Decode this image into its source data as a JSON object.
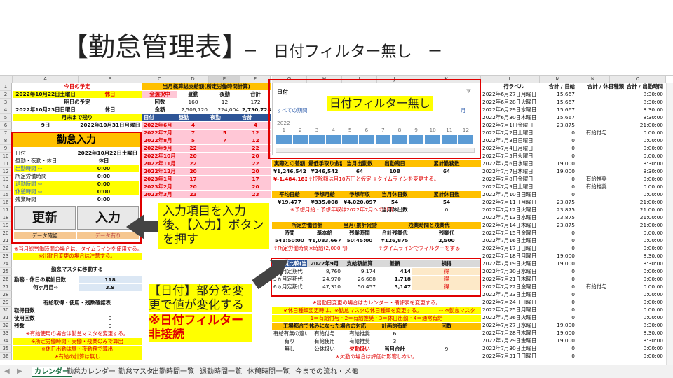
{
  "title": "【勤怠管理表】",
  "subtitle": "－　日付フィルター無し　－",
  "columns": [
    "A",
    "B",
    "C",
    "D",
    "E",
    "F",
    "G",
    "H",
    "I",
    "J",
    "K",
    "L",
    "M",
    "N",
    "O"
  ],
  "rows": [
    "1",
    "2",
    "3",
    "4",
    "5",
    "6",
    "7",
    "8",
    "9",
    "10",
    "11",
    "12",
    "13",
    "14",
    "15",
    "16",
    "17",
    "18",
    "19",
    "20",
    "21",
    "22",
    "23",
    "24",
    "25",
    "26",
    "27",
    "28",
    "29",
    "30",
    "31",
    "32",
    "33",
    "34",
    "35",
    "36"
  ],
  "left": {
    "today_label": "今日の予定",
    "r2a": "2022年10月22日土曜日",
    "r2b": "休日",
    "tomorrow_label": "明日の予定",
    "r4a": "2022年10月23日日曜日",
    "r4b": "休日",
    "month_end": "月末まで残り",
    "r6a": "9日",
    "r6b": "2022年10月31日月曜日",
    "panel_title": "勤怠入力",
    "date_lbl": "日付",
    "date_val": "2022年10月22日土曜日",
    "type_lbl": "昼勤・夜勤・休日",
    "type_val": "休日",
    "work_in": "出勤時間 ⇦",
    "work_in_v": "0:00",
    "sched_out": "所定労働時間",
    "sched_out_v": "0:00",
    "work_out": "退勤時間 ⇦",
    "work_out_v": "0:00",
    "break": "休憩時間 ⇦",
    "break_v": "0:00",
    "overtime": "残業時間",
    "overtime_v": "0:00",
    "btn_update": "更新",
    "btn_input": "入力",
    "data_confirm": "データ確認",
    "data_have": "データ有り",
    "note1": "※当月総労働時間の場合は、タイムラインを使用する。",
    "note2": "※出勤日変更の場合は注意する。",
    "master_move": "勤怠マスタに移動する",
    "attend_lbl": "勤務・休日の累計日数",
    "attend_v": "118",
    "count_lbl": "何ヶ月目⇨",
    "count_v": "3.9",
    "paid_title": "有給取得・使用・残数確認表",
    "paid_get": "取得日数",
    "paid_use": "使用回数",
    "paid_use_v": "0",
    "paid_rem": "残数",
    "paid_rem_v": "0",
    "note3": "※有給使用の場合は勤怠マスタを変更する。",
    "note4": "※所定労働時間・実働・残業のみで算出",
    "note5": "※休日出勤は昼・夜勤務で算出",
    "note6": "※有給の計算は無し"
  },
  "mid": {
    "head": "当月概算総支給額(所定労働時間計算)",
    "sel_all": "全選択中",
    "col_day": "昼勤",
    "col_night": "夜勤",
    "col_total": "合計",
    "times_lbl": "回数",
    "times_d": "160",
    "times_n": "12",
    "times_t": "172",
    "amt_lbl": "金額",
    "amt_d": "2,506,720",
    "amt_n": "224,004",
    "amt_t": "2,730,724",
    "f_date": "日付",
    "f_day": "昼勤",
    "f_night": "夜勤",
    "f_total": "合計",
    "months": [
      {
        "m": "2022年6月",
        "d": "4",
        "n": "",
        "t": "4"
      },
      {
        "m": "2022年7月",
        "d": "7",
        "n": "5",
        "t": "12"
      },
      {
        "m": "2022年8月",
        "d": "5",
        "n": "7",
        "t": "12"
      },
      {
        "m": "2022年9月",
        "d": "22",
        "n": "",
        "t": "22"
      },
      {
        "m": "2022年10月",
        "d": "20",
        "n": "",
        "t": "20"
      },
      {
        "m": "2022年11月",
        "d": "22",
        "n": "",
        "t": "22"
      },
      {
        "m": "2022年12月",
        "d": "20",
        "n": "",
        "t": "20"
      },
      {
        "m": "2023年1月",
        "d": "17",
        "n": "",
        "t": "17"
      },
      {
        "m": "2023年2月",
        "d": "20",
        "n": "",
        "t": "20"
      },
      {
        "m": "2023年3月",
        "d": "23",
        "n": "",
        "t": "23"
      }
    ]
  },
  "right": {
    "r1": [
      "実際との差額",
      "最低手取り金額",
      "当月出勤数",
      "出勤残日",
      "累計勤務数"
    ],
    "r1v": [
      "¥1,246,542",
      "¥246,542",
      "64",
      "108",
      "64"
    ],
    "r1n1": "¥-1,484,182",
    "r1n2": "⇧控除額は月10万円と仮定 ※タイムラインを変更する。",
    "r2": [
      "平均日給",
      "予想月給",
      "予想年収",
      "当月休日数",
      "累計休日数"
    ],
    "r2v": [
      "¥19,477",
      "¥335,008",
      "¥4,020,097",
      "54",
      "54"
    ],
    "r2n": "※予想月給・予想年収は2022年7月への計算",
    "r2n2": "当月休出数",
    "r2n2v": "0",
    "r3": [
      "所定労働合計",
      "",
      "当月(累計)合計",
      "残業時間と残業代",
      ""
    ],
    "r3b": [
      "時間",
      "基本給",
      "残業時間",
      "合計残業代",
      "残業代"
    ],
    "r3v": [
      "541:50:00",
      "¥1,083,667",
      "50:45:00",
      "¥126,875",
      "2,500"
    ],
    "r3n1": "⇧所定労働時間×時給(2,000円)",
    "r3n2": "⇧タイムラインでフィルターをする",
    "e_head": [
      "電車賃比較(当月含む)",
      "2022年9月",
      "支給額計算",
      "差額",
      "損得"
    ],
    "e_rows": [
      [
        "1ヵ月定期代",
        "8,760",
        "9,174",
        "414",
        "得"
      ],
      [
        "3ヵ月定期代",
        "24,970",
        "26,688",
        "1,718",
        "得"
      ],
      [
        "6ヵ月定期代",
        "47,310",
        "50,457",
        "3,147",
        "得"
      ]
    ],
    "note1": "※出勤日変更の場合はカレンダー・備評表を変更する。",
    "note2": "※休日種類変更時は、※勤怠マスタの休日種類を変更する。",
    "note2b": "⇨ ※勤怠マスタ",
    "note3": "1＝有給付与・2＝有給推奨・3＝休日出勤・4＝通常有給",
    "w_head": [
      "工場都合で休みになった場合の対応",
      "",
      "計画的有給",
      "回数"
    ],
    "w_rows": [
      [
        "有給有無の違い",
        "有給付与",
        "有給推奨",
        "6"
      ],
      [
        "有り",
        "有給使用",
        "有給推奨",
        "3"
      ],
      [
        "無し",
        "公休扱い",
        "欠勤扱い",
        "当月合計",
        "9"
      ]
    ],
    "note4": "※欠勤の場合は評価に影響しない。"
  },
  "slicer": {
    "title": "日付",
    "all": "すべての期間",
    "month": "月",
    "year": "2022",
    "months": [
      "1",
      "2",
      "3",
      "4",
      "5",
      "6",
      "7",
      "8",
      "9",
      "10",
      "11",
      "12"
    ]
  },
  "calendar": {
    "head_l": "行ラベル",
    "head_m": "合計 / 日給",
    "head_n": "合計 / 休日種類",
    "head_o": "合計 / 出勤時間",
    "rows": [
      [
        "2022年6月27日月曜日",
        "15,667",
        "",
        "8:30:00"
      ],
      [
        "2022年6月28日火曜日",
        "15,667",
        "",
        "8:30:00"
      ],
      [
        "2022年6月29日水曜日",
        "15,667",
        "",
        "8:30:00"
      ],
      [
        "2022年6月30日木曜日",
        "15,667",
        "",
        "8:30:00"
      ],
      [
        "2022年7月1日金曜日",
        "23,875",
        "",
        "21:00:00"
      ],
      [
        "2022年7月2日土曜日",
        "0",
        "有給付与",
        "0:00:00"
      ],
      [
        "2022年7月3日日曜日",
        "0",
        "",
        "0:00:00"
      ],
      [
        "2022年7月4日月曜日",
        "0",
        "",
        "0:00:00"
      ],
      [
        "2022年7月5日火曜日",
        "0",
        "",
        "0:00:00"
      ],
      [
        "2022年7月6日水曜日",
        "19,000",
        "",
        "8:30:00"
      ],
      [
        "2022年7月7日木曜日",
        "19,000",
        "",
        "8:30:00"
      ],
      [
        "2022年7月8日金曜日",
        "0",
        "有給推奨",
        "0:00:00"
      ],
      [
        "2022年7月9日土曜日",
        "0",
        "有給推奨",
        "0:00:00"
      ],
      [
        "2022年7月10日日曜日",
        "0",
        "",
        "0:00:00"
      ],
      [
        "2022年7月11日月曜日",
        "23,875",
        "",
        "21:00:00"
      ],
      [
        "2022年7月12日火曜日",
        "23,875",
        "",
        "21:00:00"
      ],
      [
        "2022年7月13日水曜日",
        "23,875",
        "",
        "21:00:00"
      ],
      [
        "2022年7月14日木曜日",
        "23,875",
        "",
        "21:00:00"
      ],
      [
        "2022年7月15日金曜日",
        "0",
        "",
        "0:00:00"
      ],
      [
        "2022年7月16日土曜日",
        "0",
        "",
        "0:00:00"
      ],
      [
        "2022年7月17日日曜日",
        "0",
        "",
        "0:00:00"
      ],
      [
        "2022年7月18日月曜日",
        "19,000",
        "",
        "8:30:00"
      ],
      [
        "2022年7月19日火曜日",
        "19,000",
        "",
        "8:30:00"
      ],
      [
        "2022年7月20日水曜日",
        "0",
        "",
        "0:00:00"
      ],
      [
        "2022年7月21日木曜日",
        "0",
        "",
        "0:00:00"
      ],
      [
        "2022年7月22日金曜日",
        "0",
        "有給付与",
        "0:00:00"
      ],
      [
        "2022年7月23日土曜日",
        "0",
        "",
        "0:00:00"
      ],
      [
        "2022年7月24日日曜日",
        "0",
        "",
        "0:00:00"
      ],
      [
        "2022年7月25日月曜日",
        "0",
        "",
        "0:00:00"
      ],
      [
        "2022年7月26日火曜日",
        "0",
        "",
        "0:00:00"
      ],
      [
        "2022年7月27日水曜日",
        "19,000",
        "",
        "8:30:00"
      ],
      [
        "2022年7月28日木曜日",
        "19,000",
        "",
        "8:30:00"
      ],
      [
        "2022年7月29日金曜日",
        "19,000",
        "",
        "8:30:00"
      ],
      [
        "2022年7月30日土曜日",
        "0",
        "",
        "0:00:00"
      ],
      [
        "2022年7月31日日曜日",
        "0",
        "",
        "0:00:00"
      ]
    ]
  },
  "callouts": {
    "slicer_label": "日付フィルター無し",
    "c1": "入力項目を入力後、【入力】ボタンを押す",
    "c2a": "【日付】部分を変更で値が変化する",
    "c2b": "※日付フィルター非接続"
  },
  "tabs": [
    "カレンダー",
    "勤怠カレンダー",
    "勤怠マスタ",
    "出勤時間一覧",
    "退勤時間一覧",
    "休憩時間一覧",
    "今までの流れ・メモ"
  ]
}
